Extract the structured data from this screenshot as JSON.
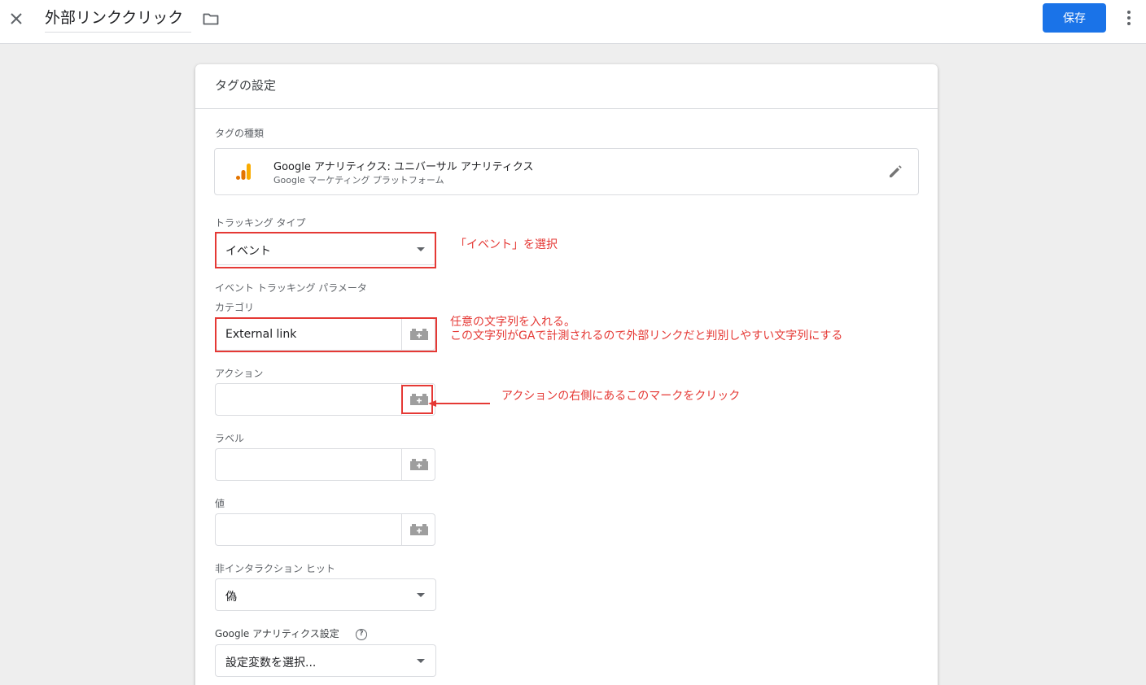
{
  "topbar": {
    "title": "外部リンククリック",
    "save_label": "保存",
    "close_icon": "close-icon",
    "folder_icon": "folder-icon",
    "more_icon": "more-vert-icon"
  },
  "card": {
    "title": "タグの設定",
    "tag_type_label": "タグの種類",
    "tag_type": {
      "title": "Google アナリティクス: ユニバーサル アナリティクス",
      "subtitle": "Google マーケティング プラットフォーム",
      "icon": "google-analytics-icon"
    },
    "tracking_type_label": "トラッキング タイプ",
    "tracking_type_value": "イベント",
    "event_params_label": "イベント トラッキング パラメータ",
    "fields": {
      "category_label": "カテゴリ",
      "category_value": "External link",
      "action_label": "アクション",
      "action_value": "",
      "label_label": "ラベル",
      "label_value": "",
      "value_label": "値",
      "value_value": ""
    },
    "non_interaction_label": "非インタラクション ヒット",
    "non_interaction_value": "偽",
    "ga_settings_label": "Google アナリティクス設定",
    "ga_settings_value": "設定変数を選択..."
  },
  "annotations": {
    "event_note": "「イベント」を選択",
    "category_note_1": "任意の文字列を入れる。",
    "category_note_2": "この文字列がGAで計測されるので外部リンクだと判別しやすい文字列にする",
    "action_note": "アクションの右側にあるこのマークをクリック"
  },
  "colors": {
    "accent": "#1a73e8",
    "annotation": "#e53935",
    "ga_orange": "#f9ab00",
    "ga_dark_orange": "#e37400"
  }
}
